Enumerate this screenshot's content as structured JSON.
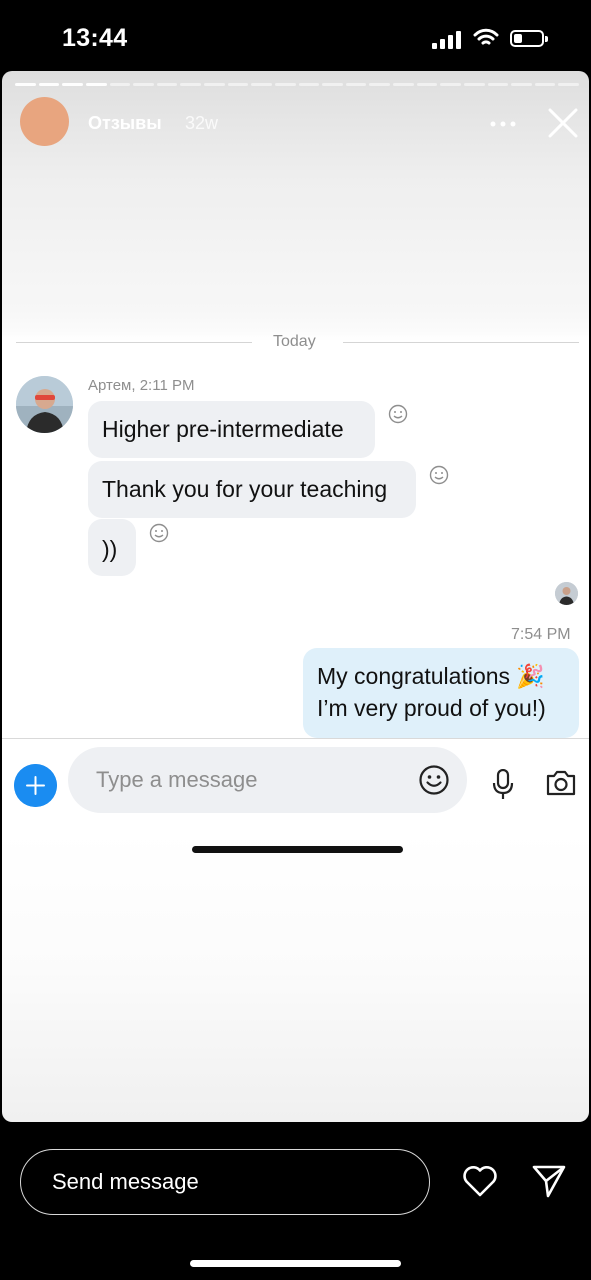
{
  "status_bar": {
    "time": "13:44"
  },
  "story": {
    "account_name": "Отзывы",
    "age": "32w",
    "colors": {
      "avatar": "#e8a57f"
    }
  },
  "chat": {
    "divider_label": "Today",
    "sender_meta": "Артем, 2:11 PM",
    "incoming": [
      {
        "text": "Higher pre-intermediate"
      },
      {
        "text": "Thank you for your teaching"
      },
      {
        "text": "))"
      }
    ],
    "outgoing_time": "7:54 PM",
    "outgoing": {
      "line1": "My congratulations 🎉",
      "line2": "I’m very proud of you!)"
    },
    "input_placeholder": "Type a message",
    "colors": {
      "incoming_bubble": "#eef0f3",
      "outgoing_bubble": "#dff0fa",
      "accent": "#1a8cf1"
    }
  },
  "reply": {
    "placeholder": "Send message"
  },
  "icons": {
    "more": "more-dots-icon",
    "close": "close-icon",
    "react": "smiley-icon",
    "plus": "plus-icon",
    "emoji": "emoji-icon",
    "mic": "microphone-icon",
    "camera": "camera-icon",
    "heart": "heart-icon",
    "send": "send-icon"
  }
}
